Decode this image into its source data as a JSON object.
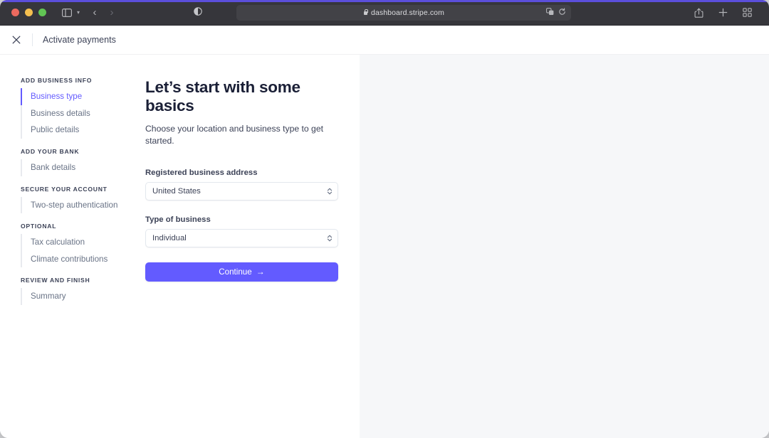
{
  "browser": {
    "url": "dashboard.stripe.com",
    "lock_icon": "lock-icon",
    "traffic_lights": [
      "close",
      "minimize",
      "zoom"
    ],
    "sidebar_toggle_icon": "sidebar-toggle-icon",
    "tab_group_chevron_icon": "chevron-down-icon",
    "back_icon": "chevron-left-icon",
    "forward_icon": "chevron-right-icon",
    "reader_icon": "reader-view-icon",
    "extensions_icon": "extensions-icon",
    "reload_icon": "reload-icon",
    "share_icon": "share-icon",
    "new_tab_icon": "plus-icon",
    "tab_overview_icon": "tab-overview-icon"
  },
  "app_header": {
    "close_icon": "close-icon",
    "title": "Activate payments"
  },
  "sidebar": {
    "groups": [
      {
        "title": "ADD BUSINESS INFO",
        "items": [
          {
            "label": "Business type",
            "active": true
          },
          {
            "label": "Business details",
            "active": false
          },
          {
            "label": "Public details",
            "active": false
          }
        ]
      },
      {
        "title": "ADD YOUR BANK",
        "items": [
          {
            "label": "Bank details",
            "active": false
          }
        ]
      },
      {
        "title": "SECURE YOUR ACCOUNT",
        "items": [
          {
            "label": "Two-step authentication",
            "active": false
          }
        ]
      },
      {
        "title": "OPTIONAL",
        "items": [
          {
            "label": "Tax calculation",
            "active": false
          },
          {
            "label": "Climate contributions",
            "active": false
          }
        ]
      },
      {
        "title": "REVIEW AND FINISH",
        "items": [
          {
            "label": "Summary",
            "active": false
          }
        ]
      }
    ]
  },
  "main": {
    "title": "Let’s start with some basics",
    "subtitle": "Choose your location and business type to get started.",
    "fields": [
      {
        "label": "Registered business address",
        "value": "United States",
        "options": [
          "United States"
        ]
      },
      {
        "label": "Type of business",
        "value": "Individual",
        "options": [
          "Individual"
        ]
      }
    ],
    "continue_label": "Continue",
    "continue_arrow": "→"
  },
  "colors": {
    "accent": "#635bff",
    "accent_strip": "#5b4fdb",
    "chrome_bg": "#36363b",
    "right_pane_bg": "#f6f7f9",
    "text_dark": "#1a1f36",
    "text_muted": "#697386",
    "border": "#e3e8ee"
  }
}
